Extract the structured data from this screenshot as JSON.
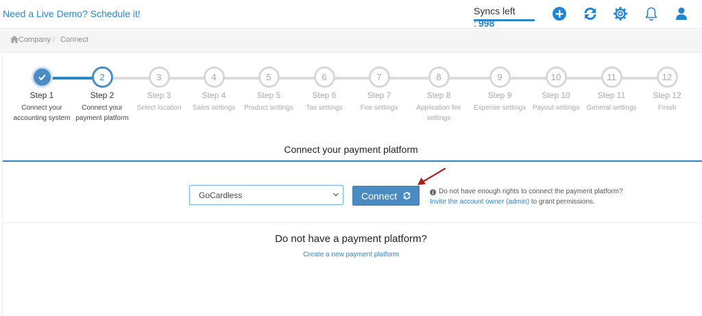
{
  "header": {
    "demo_link": "Need a Live Demo? Schedule it!",
    "syncs_label": "Syncs left :",
    "syncs_value": "998",
    "icons": [
      "plus-circle-icon",
      "sync-icon",
      "gear-icon",
      "bell-icon",
      "user-icon"
    ],
    "accent_color": "#2a85c9"
  },
  "breadcrumb": {
    "items": [
      "Company",
      "/",
      "Connect"
    ]
  },
  "steps": [
    {
      "number": "",
      "title": "Step 1",
      "sub": "Connect your accounting system",
      "state": "done"
    },
    {
      "number": "2",
      "title": "Step 2",
      "sub": "Connect your payment platform",
      "state": "active"
    },
    {
      "number": "3",
      "title": "Step 3",
      "sub": "Select location",
      "state": "todo"
    },
    {
      "number": "4",
      "title": "Step 4",
      "sub": "Sales settings",
      "state": "todo"
    },
    {
      "number": "5",
      "title": "Step 5",
      "sub": "Product settings",
      "state": "todo"
    },
    {
      "number": "6",
      "title": "Step 6",
      "sub": "Tax settings",
      "state": "todo"
    },
    {
      "number": "7",
      "title": "Step 7",
      "sub": "Fee settings",
      "state": "todo"
    },
    {
      "number": "8",
      "title": "Step 8",
      "sub": "Application fee settings",
      "state": "todo"
    },
    {
      "number": "9",
      "title": "Step 9",
      "sub": "Expense settings",
      "state": "todo"
    },
    {
      "number": "10",
      "title": "Step 10",
      "sub": "Payout settings",
      "state": "todo"
    },
    {
      "number": "11",
      "title": "Step 11",
      "sub": "General settings",
      "state": "todo"
    },
    {
      "number": "12",
      "title": "Step 12",
      "sub": "Finish",
      "state": "todo"
    }
  ],
  "main": {
    "section_title": "Connect your payment platform",
    "platform_select_value": "GoCardless",
    "connect_label": "Connect",
    "info_text": "Do not have enough rights to connect the payment platform?",
    "info_link": "Invite the account owner (admin)",
    "info_suffix": " to grant permissions.",
    "no_platform_title": "Do not have a payment platform?",
    "create_link": "Create a new payment platform"
  }
}
